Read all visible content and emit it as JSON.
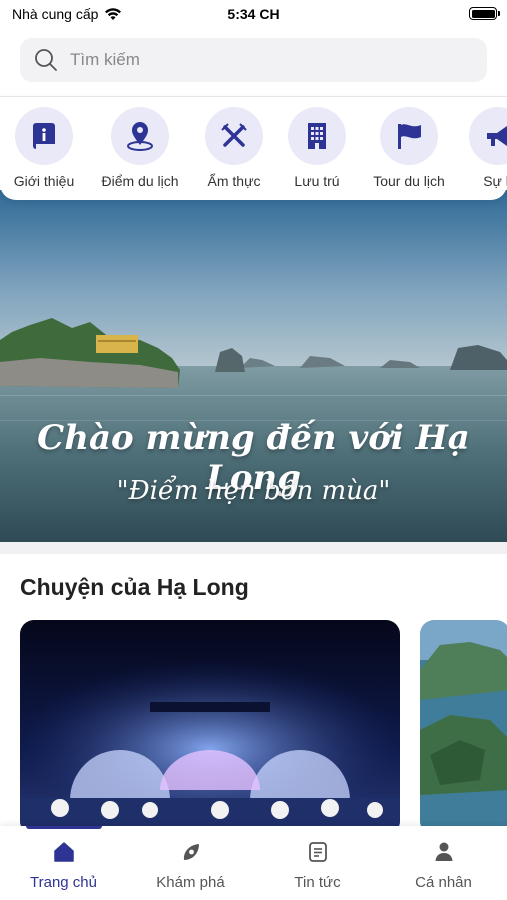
{
  "status_bar": {
    "carrier": "Nhà cung cấp",
    "time": "5:34 CH"
  },
  "search": {
    "placeholder": "Tìm kiếm"
  },
  "categories": [
    {
      "label": "Giới thiệu",
      "icon": "info-book-icon"
    },
    {
      "label": "Điểm du lịch",
      "icon": "location-pin-icon"
    },
    {
      "label": "Ẩm thực",
      "icon": "fork-knife-icon"
    },
    {
      "label": "Lưu trú",
      "icon": "building-icon"
    },
    {
      "label": "Tour du lịch",
      "icon": "flag-icon"
    },
    {
      "label": "Sự k",
      "icon": "megaphone-icon"
    }
  ],
  "hero": {
    "title": "Chào mừng đến với Hạ Long",
    "subtitle": "\"Điểm hẹn bốn mùa\""
  },
  "stories": {
    "title": "Chuyện của Hạ Long"
  },
  "bottom_nav": [
    {
      "label": "Trang chủ",
      "icon": "home-icon",
      "active": true
    },
    {
      "label": "Khám phá",
      "icon": "explore-icon",
      "active": false
    },
    {
      "label": "Tin tức",
      "icon": "news-icon",
      "active": false
    },
    {
      "label": "Cá nhân",
      "icon": "person-icon",
      "active": false
    }
  ],
  "colors": {
    "accent": "#2d3494",
    "icon_bg": "#e9e9f7"
  }
}
